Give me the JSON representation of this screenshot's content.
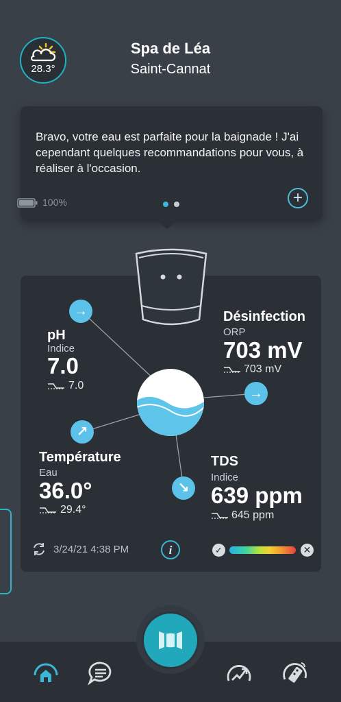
{
  "header": {
    "weather_temp": "28.3°",
    "weather_icon": "partly-sunny-icon",
    "title": "Spa de Léa",
    "subtitle": "Saint-Cannat"
  },
  "message": {
    "text": "Bravo, votre eau est parfaite pour la baignade ! J'ai cependant quelques recommandations pour vous, à réaliser à l'occasion.",
    "battery_pct": "100%",
    "pager": {
      "count": 2,
      "active": 0
    },
    "add_icon": "plus-circle-icon"
  },
  "measurements": {
    "ph": {
      "title": "pH",
      "sub": "Indice",
      "value": "7.0",
      "trend": "7.0",
      "arrow": "right"
    },
    "disinfection": {
      "title": "Désinfection",
      "sub": "ORP",
      "value": "703 mV",
      "trend": "703 mV",
      "arrow": "right"
    },
    "temperature": {
      "title": "Température",
      "sub": "Eau",
      "value": "36.0°",
      "trend": "29.4°",
      "arrow": "up-right"
    },
    "tds": {
      "title": "TDS",
      "sub": "Indice",
      "value": "639 ppm",
      "trend": "645 ppm",
      "arrow": "down-right"
    }
  },
  "footer": {
    "sync_date": "3/24/21 4:38 PM",
    "info_label": "i",
    "scale_ok": "✓",
    "scale_bad": "✕"
  },
  "nav": {
    "items": [
      "home-icon",
      "chat-icon",
      "spa-icon",
      "dashboard-icon",
      "remote-icon"
    ],
    "active": "home-icon"
  },
  "colors": {
    "accent": "#21a8bb",
    "background": "#3a4048",
    "card": "#2b3036",
    "arrow": "#5cc2ea"
  }
}
